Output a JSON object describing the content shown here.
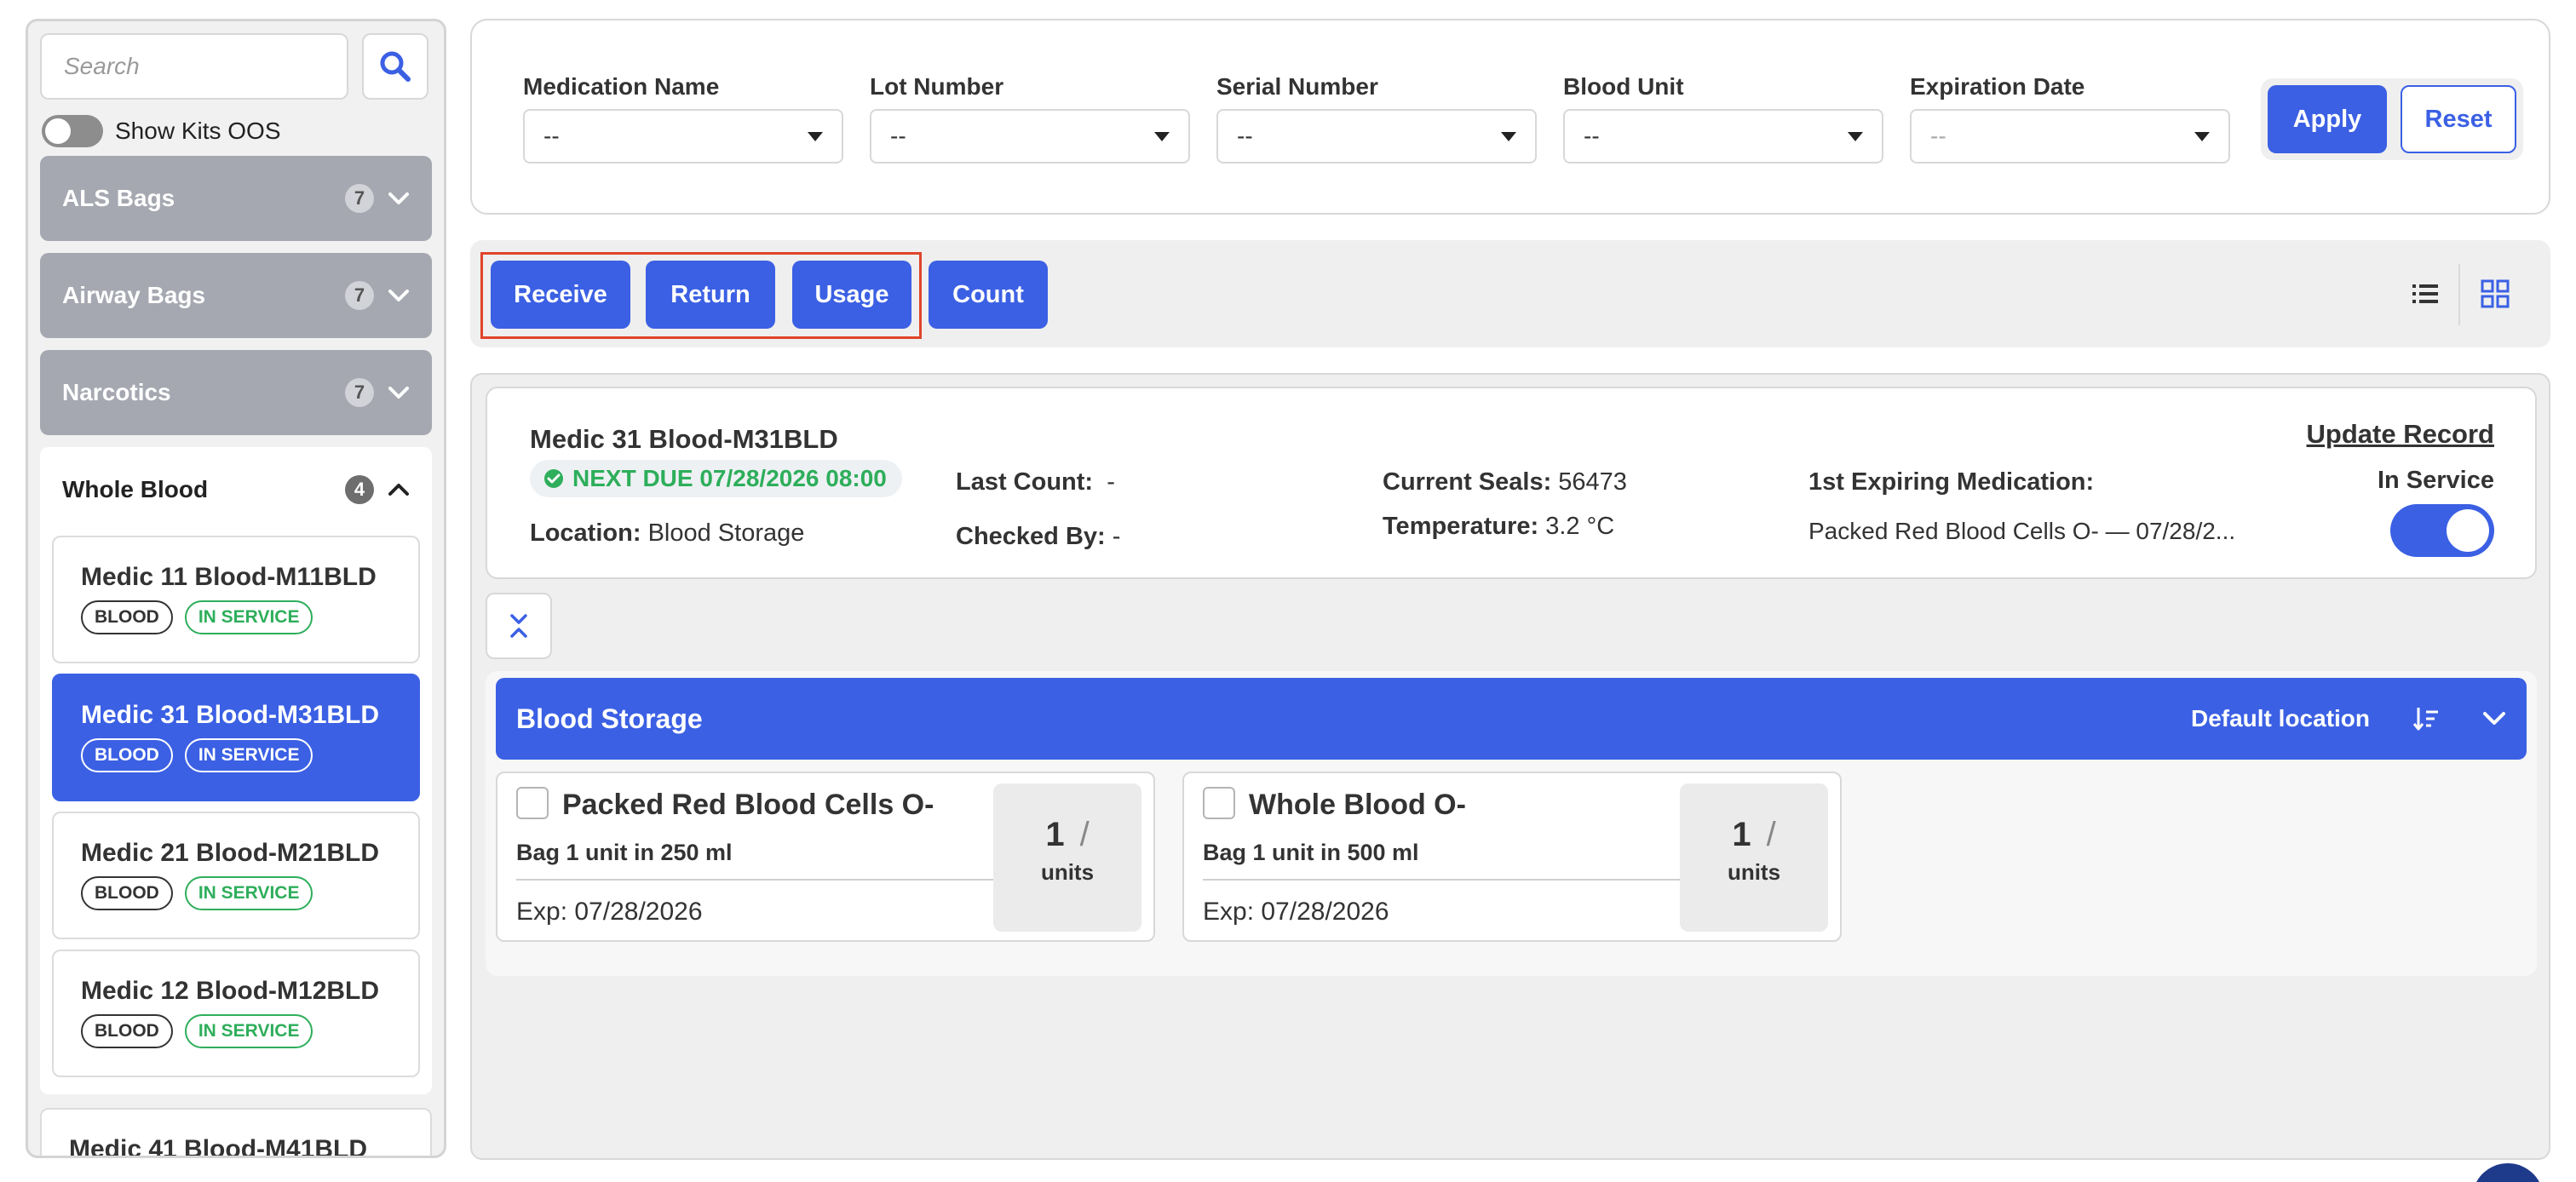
{
  "sidebar": {
    "search_placeholder": "Search",
    "show_oos_label": "Show Kits OOS",
    "groups": [
      {
        "label": "ALS Bags",
        "count": "7"
      },
      {
        "label": "Airway Bags",
        "count": "7"
      },
      {
        "label": "Narcotics",
        "count": "7"
      }
    ],
    "whole_blood": {
      "label": "Whole Blood",
      "count": "4",
      "kits": [
        {
          "title": "Medic 11 Blood-M11BLD",
          "tag_type": "BLOOD",
          "tag_status": "IN SERVICE"
        },
        {
          "title": "Medic 31 Blood-M31BLD",
          "tag_type": "BLOOD",
          "tag_status": "IN SERVICE"
        },
        {
          "title": "Medic 21 Blood-M21BLD",
          "tag_type": "BLOOD",
          "tag_status": "IN SERVICE"
        },
        {
          "title": "Medic 12 Blood-M12BLD",
          "tag_type": "BLOOD",
          "tag_status": "IN SERVICE"
        }
      ]
    },
    "partial_kit_title": "Medic 41 Blood-M41BLD"
  },
  "filters": {
    "medication_name": {
      "label": "Medication Name",
      "value": "--"
    },
    "lot_number": {
      "label": "Lot Number",
      "value": "--"
    },
    "serial_number": {
      "label": "Serial Number",
      "value": "--"
    },
    "blood_unit": {
      "label": "Blood Unit",
      "value": "--"
    },
    "expiration_date": {
      "label": "Expiration Date",
      "value": "--"
    },
    "apply_label": "Apply",
    "reset_label": "Reset"
  },
  "actions": {
    "receive": "Receive",
    "return": "Return",
    "usage": "Usage",
    "count": "Count"
  },
  "kit_info": {
    "title": "Medic 31 Blood-M31BLD",
    "next_due": "NEXT DUE 07/28/2026 08:00",
    "location_label": "Location:",
    "location_value": "Blood Storage",
    "last_count_label": "Last Count:",
    "last_count_value": "-",
    "checked_by_label": "Checked By:",
    "checked_by_value": "-",
    "current_seals_label": "Current Seals:",
    "current_seals_value": "56473",
    "temperature_label": "Temperature:",
    "temperature_value": "3.2 °C",
    "first_expiring_label": "1st Expiring Medication:",
    "first_expiring_value": "Packed Red Blood Cells O- — 07/28/2...",
    "update_record": "Update Record",
    "in_service_label": "In Service"
  },
  "location": {
    "title": "Blood Storage",
    "default_label": "Default location",
    "items": [
      {
        "name": "Packed Red Blood Cells O-",
        "package": "Bag 1 unit in 250 ml",
        "expiration": "Exp: 07/28/2026",
        "qty": "1",
        "slash": "/",
        "unit": "units"
      },
      {
        "name": "Whole Blood O-",
        "package": "Bag 1 unit in 500 ml",
        "expiration": "Exp: 07/28/2026",
        "qty": "1",
        "slash": "/",
        "unit": "units"
      }
    ]
  },
  "colors": {
    "accent": "#3b60e4",
    "success": "#2eae5b",
    "group_bg": "#a5a8b0",
    "highlight": "#e0442b"
  },
  "icons": {
    "search": "search-icon",
    "list_view": "list-view-icon",
    "grid_view": "grid-view-icon",
    "sort": "sort-descending-icon",
    "collapse": "double-chevron-up-icon",
    "check_circle": "check-circle-icon"
  }
}
